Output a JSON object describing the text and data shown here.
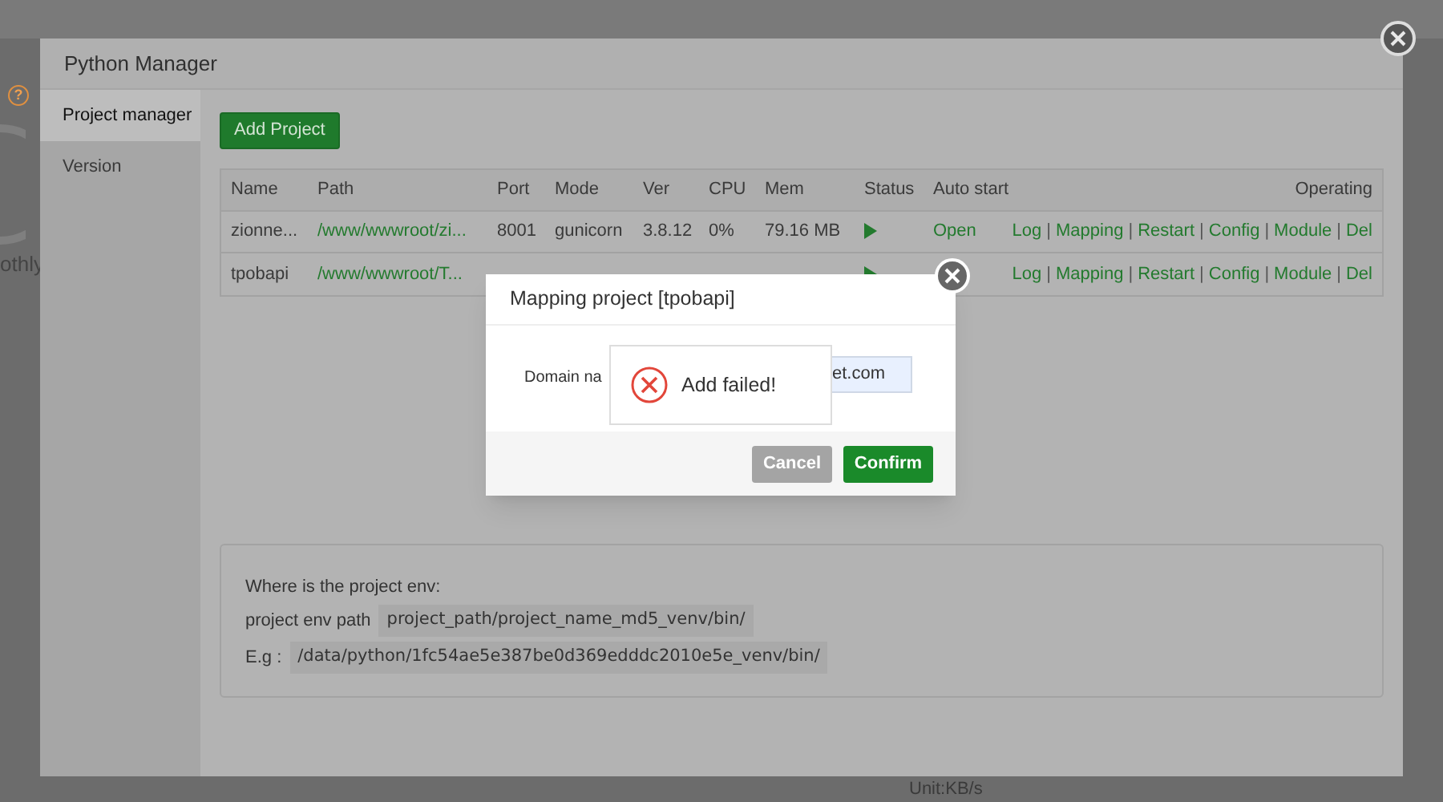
{
  "background": {
    "help_glyph": "?",
    "snippet": "othly",
    "unit_label": "Unit:KB/s"
  },
  "window": {
    "title": "Python Manager"
  },
  "sidebar": {
    "items": [
      {
        "label": "Project manager",
        "selected": true
      },
      {
        "label": "Version",
        "selected": false
      }
    ]
  },
  "add_button": "Add Project",
  "table": {
    "columns": [
      "Name",
      "Path",
      "Port",
      "Mode",
      "Ver",
      "CPU",
      "Mem",
      "Status",
      "Auto start",
      "Operating"
    ],
    "separator": "|",
    "rows": [
      {
        "name": "zionne...",
        "path": "/www/wwwroot/zi...",
        "port": "8001",
        "mode": "gunicorn",
        "ver": "3.8.12",
        "cpu": "0%",
        "mem": "79.16 MB",
        "running": true,
        "auto_start": "Open",
        "operations": [
          "Log",
          "Mapping",
          "Restart",
          "Config",
          "Module",
          "Del"
        ]
      },
      {
        "name": "tpobapi",
        "path": "/www/wwwroot/T...",
        "running": true,
        "operations": [
          "Log",
          "Mapping",
          "Restart",
          "Config",
          "Module",
          "Del"
        ]
      }
    ]
  },
  "env_info": {
    "title": "Where is the project env:",
    "path_label": "project env path",
    "path_value": "project_path/project_name_md5_venv/bin/",
    "example_label": "E.g :",
    "example_value": "/data/python/1fc54ae5e387be0d369edddc2010e5e_venv/bin/"
  },
  "dialog": {
    "title": "Mapping project [tpobapi]",
    "domain_label": "Domain na",
    "domain_value": "et.com",
    "buttons": [
      {
        "label": "Cancel",
        "kind": "secondary"
      },
      {
        "label": "Confirm",
        "kind": "primary"
      }
    ]
  },
  "toast": {
    "message": "Add failed!"
  }
}
